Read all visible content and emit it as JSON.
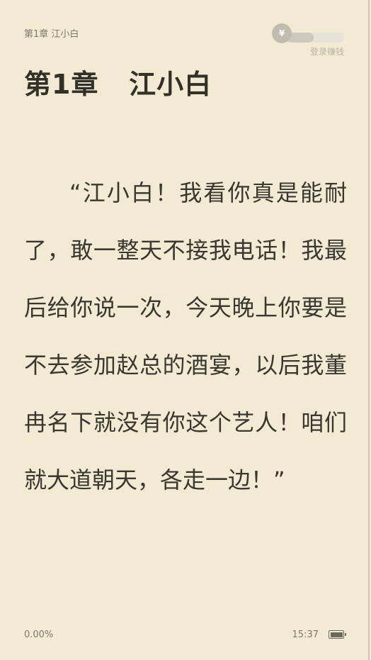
{
  "header": {
    "chapter_label": "第1章 江小白"
  },
  "earn_widget": {
    "coin_symbol": "¥",
    "label": "登录赚钱"
  },
  "chapter": {
    "title": "第1章   江小白",
    "body": "“江小白！我看你真是能耐了，敢一整天不接我电话！我最后给你说一次，今天晚上你要是不去参加赵总的酒宴，以后我董冉名下就没有你这个艺人！咱们就大道朝天，各走一边！”"
  },
  "footer": {
    "progress": "0.00%",
    "time": "15:37",
    "battery_level": 1.0
  },
  "colors": {
    "background": "#f3ead4",
    "text": "#3a3730",
    "muted_text": "#7d786e"
  }
}
